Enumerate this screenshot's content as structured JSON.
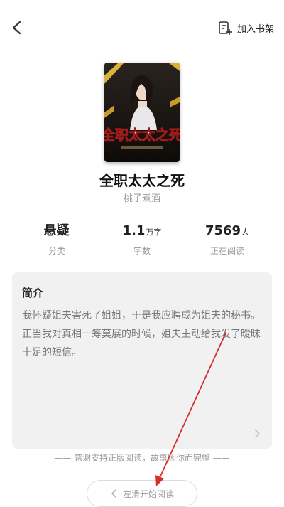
{
  "header": {
    "back_icon": "chevron-left-icon",
    "shelf_icon": "add-to-shelf-icon",
    "shelf_label": "加入书架"
  },
  "book": {
    "cover_title_art": "全职太太之死",
    "title": "全职太太之死",
    "author": "桃子煮酒"
  },
  "stats": [
    {
      "value": "悬疑",
      "unit": "",
      "label": "分类"
    },
    {
      "value": "1.1",
      "unit": "万字",
      "label": "字数"
    },
    {
      "value": "7569",
      "unit": "人",
      "label": "正在阅读"
    }
  ],
  "intro": {
    "title": "简介",
    "text": "我怀疑姐夫害死了姐姐，于是我应聘成为姐夫的秘书。正当我对真相一筹莫展的时候，姐夫主动给我发了暧昧十足的短信。",
    "more_icon": "chevron-right-icon"
  },
  "footer": {
    "thanks": "—— 感谢支持正版阅读，故事因你而完整 ——",
    "start_icon": "chevron-left-icon",
    "start_label": "左滑开始阅读"
  },
  "colors": {
    "background": "#ffffff",
    "card": "#f1f1f1",
    "annotation_arrow": "#d32f2f",
    "muted_text": "#9a9a9a"
  }
}
